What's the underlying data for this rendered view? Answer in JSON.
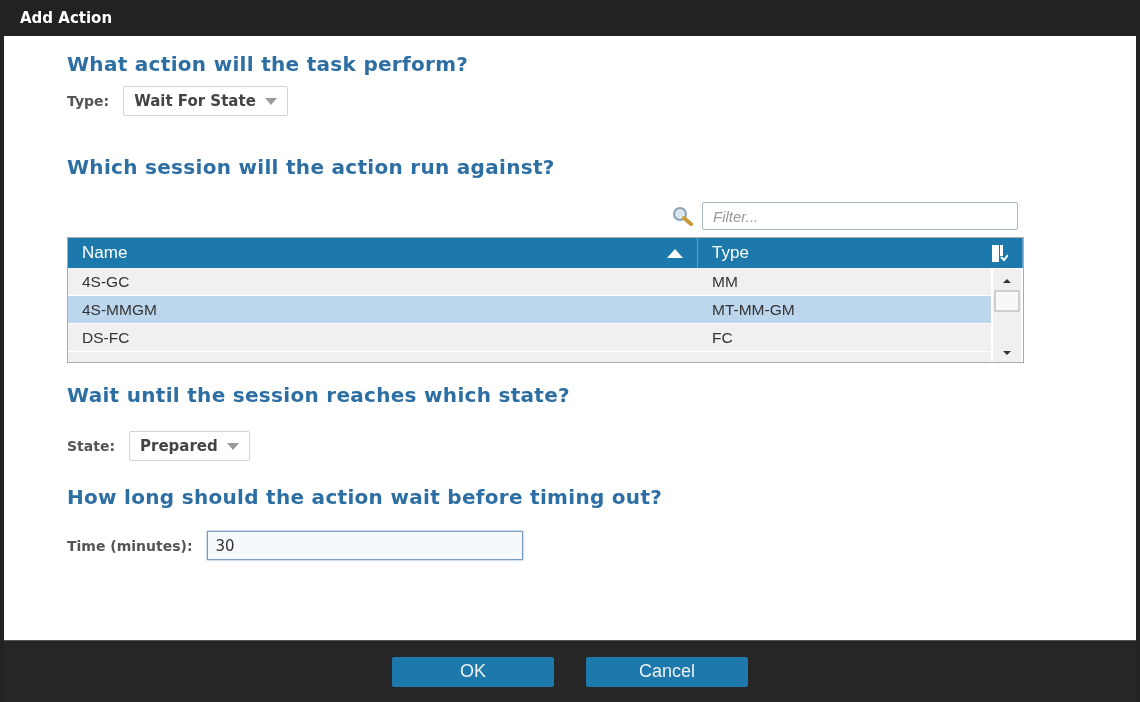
{
  "window": {
    "title": "Add Action"
  },
  "action_section": {
    "heading": "What action will the task perform?",
    "type_field": {
      "label": "Type:",
      "value": "Wait For State"
    }
  },
  "session_section": {
    "heading": "Which session will the action run against?",
    "filter": {
      "placeholder": "Filter..."
    },
    "table": {
      "columns": [
        {
          "label": "Name",
          "sorted": true
        },
        {
          "label": "Type",
          "sorted": false
        }
      ],
      "rows": [
        {
          "cells": [
            "4S-GC",
            "MM"
          ],
          "selected": false
        },
        {
          "cells": [
            "4S-MMGM",
            "MT-MM-GM"
          ],
          "selected": true
        },
        {
          "cells": [
            "DS-FC",
            "FC"
          ],
          "selected": false
        }
      ]
    }
  },
  "state_section": {
    "heading": "Wait until the session reaches which state?",
    "state_field": {
      "label": "State:",
      "value": "Prepared"
    }
  },
  "timeout_section": {
    "heading": "How long should the action wait before timing out?",
    "time_field": {
      "label": "Time (minutes):",
      "value": "30",
      "focused": true
    }
  },
  "buttons": [
    {
      "label": "OK"
    },
    {
      "label": "Cancel"
    }
  ]
}
